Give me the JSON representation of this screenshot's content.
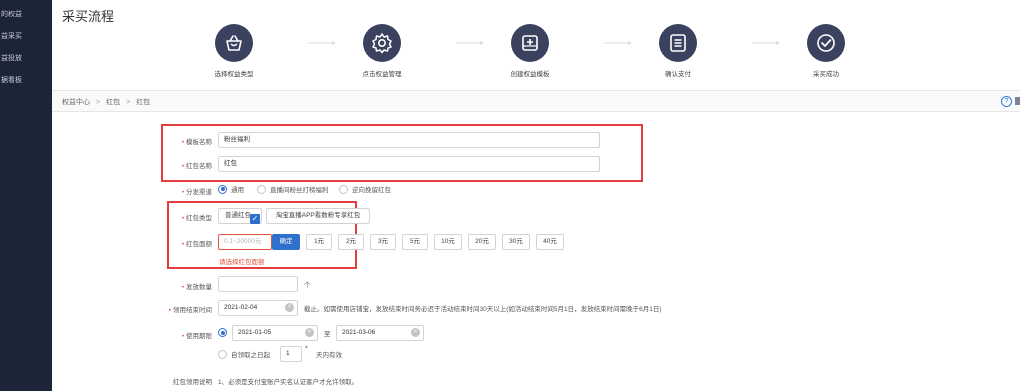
{
  "sidebar": {
    "items": [
      "的权益",
      "益采买",
      "益投放",
      "据看板"
    ]
  },
  "page_title": "采买流程",
  "steps": [
    {
      "label": "选择权益类型",
      "icon": "basket-icon"
    },
    {
      "label": "点击权益管理",
      "icon": "gear-icon"
    },
    {
      "label": "创建权益模板",
      "icon": "add-box-icon"
    },
    {
      "label": "确认支付",
      "icon": "list-icon"
    },
    {
      "label": "采买成功",
      "icon": "check-icon"
    }
  ],
  "breadcrumb": [
    "权益中心",
    "红包",
    "红包"
  ],
  "form": {
    "template_name": {
      "label": "模板名称",
      "value": "粉丝福利"
    },
    "redpack_name": {
      "label": "红包名称",
      "value": "红包"
    },
    "channel": {
      "label": "分发渠道",
      "options": [
        "通用",
        "直播间粉丝打榜福利",
        "逆向挽留红包"
      ],
      "selected": 0
    },
    "redpack_type": {
      "label": "红包类型",
      "options": [
        "普通红包",
        "淘宝直播APP看数粉专享红包"
      ]
    },
    "amount": {
      "label": "红包面额",
      "placeholder": "0.1~20000元",
      "confirm_label": "确定",
      "presets": [
        "1元",
        "2元",
        "3元",
        "5元",
        "10元",
        "20元",
        "30元",
        "40元"
      ],
      "error": "请选择红包面额"
    },
    "quantity": {
      "label": "发放数量",
      "unit": "个"
    },
    "claim_end": {
      "label": "领用结束时间",
      "value": "2021-02-04",
      "note": "截止。如需使用店铺宝，发放结束时间务必迟于活动结束时间30天以上(如活动结束时间5月1日，发放结束时间需晚于6月1日)"
    },
    "validity": {
      "label": "使用期限",
      "start": "2021-01-05",
      "to_label": "至",
      "end": "2021-03-06",
      "relative_label": "自领取之日起",
      "relative_value": "1",
      "relative_suffix": "天内有效"
    },
    "instructions": {
      "label": "红包领用说明",
      "text": "1、必须是支付宝账户实名认证客户才允许领取。"
    }
  },
  "colors": {
    "accent": "#2f6fce",
    "sidebar": "#1c2438",
    "step_icon_bg": "#3b4260",
    "error": "#e0533d",
    "highlight_box": "#e43d3d"
  }
}
